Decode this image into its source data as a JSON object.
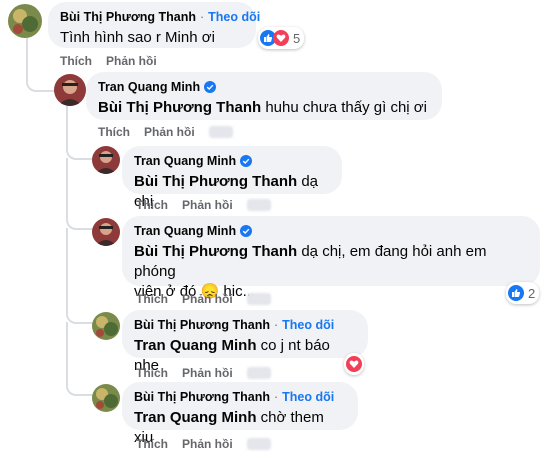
{
  "labels": {
    "like": "Thích",
    "reply": "Phản hồi",
    "follow": "Theo dõi"
  },
  "colors": {
    "accent": "#1877f2",
    "bubble": "#f0f2f5",
    "heart": "#f33e58"
  },
  "comments": [
    {
      "author": "Bùi Thị Phương Thanh",
      "mention": "",
      "text": "Tình hình sao r Minh ơi",
      "reaction_count": "5"
    },
    {
      "author": "Tran Quang Minh",
      "mention": "Bùi Thị Phương Thanh",
      "text": " huhu chưa thấy gì chị ơi"
    },
    {
      "author": "Tran Quang Minh",
      "mention": "Bùi Thị Phương Thanh",
      "text": " dạ chị"
    },
    {
      "author": "Tran Quang Minh",
      "mention": "Bùi Thị Phương Thanh",
      "text": " dạ chị, em đang hỏi anh em phóng",
      "text2": "viên ở đó",
      "text3": " hic...",
      "emoji": "😞",
      "reaction_count": "2"
    },
    {
      "author": "Bùi Thị Phương Thanh",
      "mention": "Tran Quang Minh",
      "text": " co j nt báo nhe"
    },
    {
      "author": "Bùi Thị Phương Thanh",
      "mention": "Tran Quang Minh",
      "text": " chờ them xiu"
    }
  ]
}
